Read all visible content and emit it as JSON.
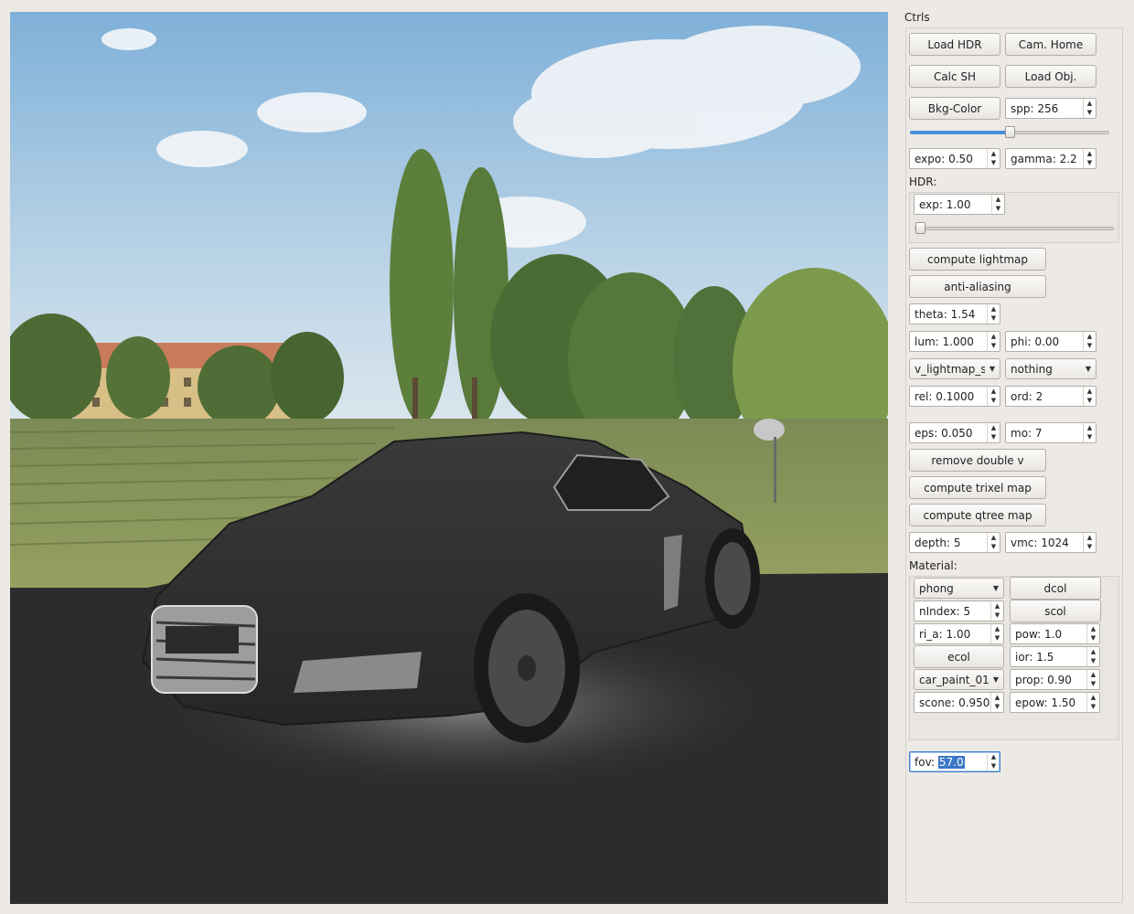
{
  "panel": {
    "title": "Ctrls",
    "buttons": {
      "load_hdr": "Load HDR",
      "cam_home": "Cam. Home",
      "calc_sh": "Calc SH",
      "load_obj": "Load Obj.",
      "bkg_color": "Bkg-Color",
      "compute_lightmap": "compute lightmap",
      "anti_aliasing": "anti-aliasing",
      "remove_double_v": "remove double v",
      "compute_trixel_map": "compute trixel map",
      "compute_qtree_map": "compute qtree map"
    },
    "spp": {
      "label": "spp:",
      "value": "256"
    },
    "spp_slider_fraction": 0.5,
    "expo": {
      "label": "expo:",
      "value": "0.50"
    },
    "gamma": {
      "label": "gamma:",
      "value": "2.2"
    },
    "hdr_label": "HDR:",
    "hdr_exp": {
      "label": "exp:",
      "value": "1.00"
    },
    "hdr_slider_fraction": 0.0,
    "theta": {
      "label": "theta:",
      "value": "1.54"
    },
    "lum": {
      "label": "lum:",
      "value": "1.000"
    },
    "phi": {
      "label": "phi:",
      "value": "0.00"
    },
    "lightmap_select": "v_lightmap_s",
    "nothing_select": "nothing",
    "rel": {
      "label": "rel:",
      "value": "0.1000"
    },
    "ord": {
      "label": "ord:",
      "value": "2"
    },
    "eps": {
      "label": "eps:",
      "value": "0.050"
    },
    "mo": {
      "label": "mo:",
      "value": "7"
    },
    "depth": {
      "label": "depth:",
      "value": "5"
    },
    "vmc": {
      "label": "vmc:",
      "value": "1024"
    },
    "fov": {
      "label": "fov:",
      "value": "57.0"
    }
  },
  "material": {
    "label": "Material:",
    "shader_select": "phong",
    "dcol": "dcol",
    "nindex": {
      "label": "nIndex:",
      "value": "5"
    },
    "scol": "scol",
    "ri_a": {
      "label": "ri_a:",
      "value": "1.00"
    },
    "pow": {
      "label": "pow:",
      "value": "1.0"
    },
    "ecol": "ecol",
    "ior": {
      "label": "ior:",
      "value": "1.5"
    },
    "paint_select": "car_paint_01",
    "prop": {
      "label": "prop:",
      "value": "0.90"
    },
    "scone": {
      "label": "scone:",
      "value": "0.950"
    },
    "epow": {
      "label": "epow:",
      "value": "1.50"
    }
  },
  "colors": {
    "slider_fill": "#4a90d9",
    "floor": "#2c2c2c",
    "sky": "#a9c8e2",
    "selection": "#3a77c6"
  },
  "icons": {
    "spin_up": "▲",
    "spin_down": "▼",
    "combo_arrow": "▼"
  }
}
